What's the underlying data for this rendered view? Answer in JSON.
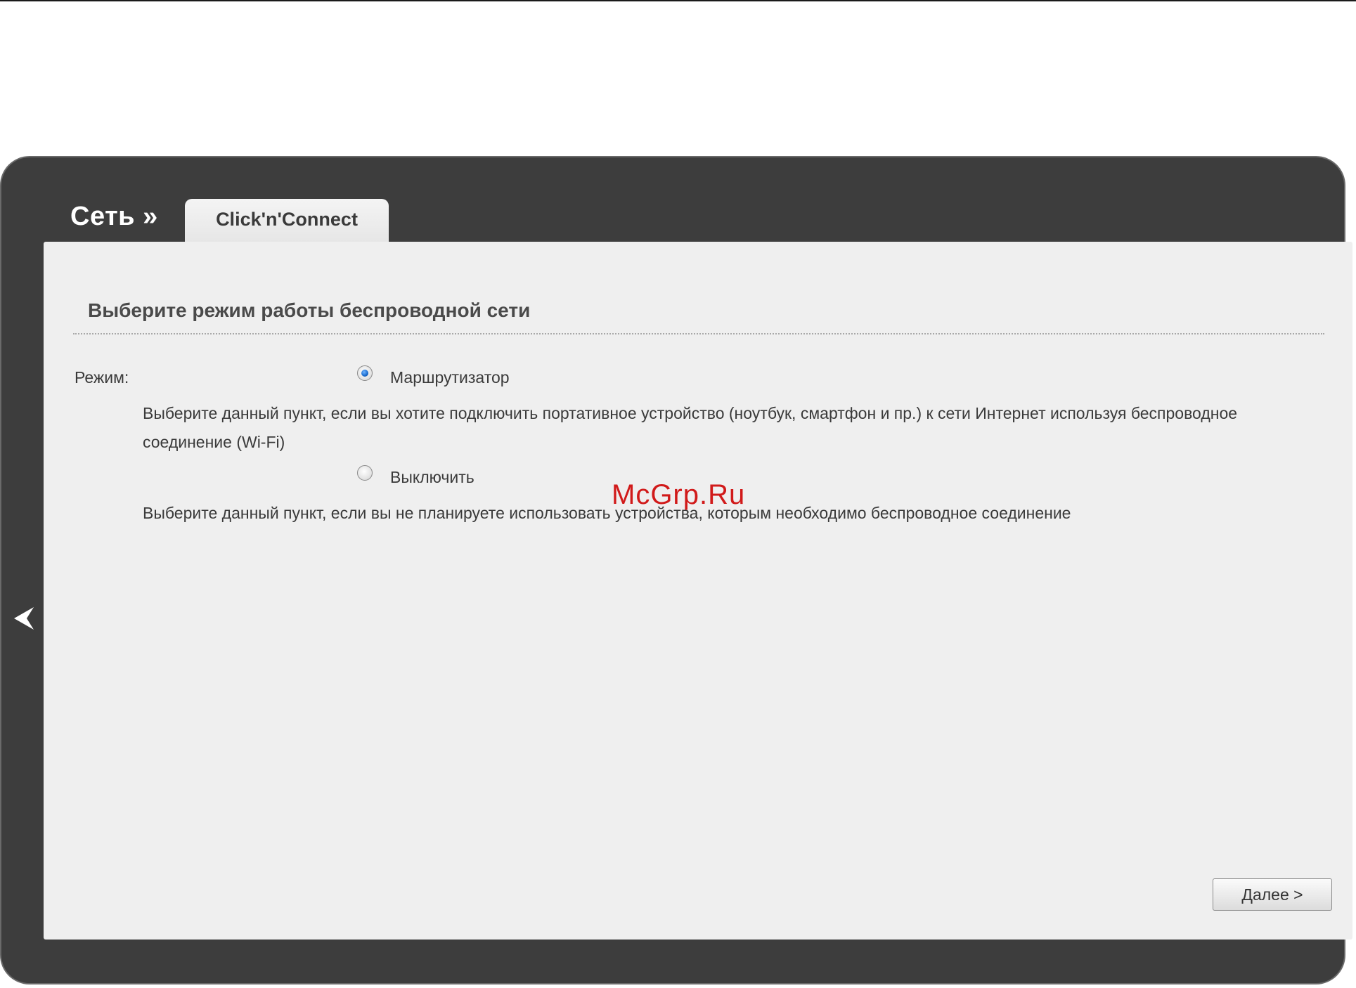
{
  "header": {
    "section_title": "Сеть »",
    "tab_label": "Click'n'Connect"
  },
  "main": {
    "heading": "Выберите режим работы беспроводной сети",
    "mode_label": "Режим:",
    "options": [
      {
        "label": "Маршрутизатор",
        "checked": true,
        "description_line1": "Выберите данный пункт, если вы хотите подключить портативное устройство (ноутбук, смартфон и пр.) к сети Интернет используя беспроводное",
        "description_line2": "соединение (Wi-Fi)"
      },
      {
        "label": "Выключить",
        "checked": false,
        "description_line1": "Выберите данный пункт, если вы не планируете использовать устройства, которым необходимо беспроводное соединение"
      }
    ],
    "next_button": "Далее >"
  },
  "watermark": "McGrp.Ru",
  "icons": {
    "back": "chevron-left-icon"
  },
  "colors": {
    "frame": "#3d3d3d",
    "panel": "#efefef",
    "radio_selected": "#1d6fd1",
    "watermark": "#d11a1a"
  }
}
